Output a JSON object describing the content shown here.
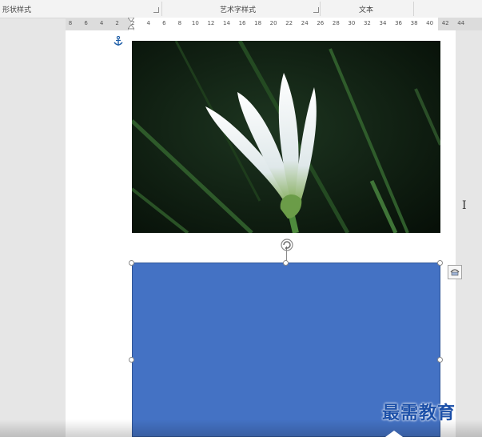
{
  "ribbon": {
    "groups": [
      {
        "label": "形状样式"
      },
      {
        "label": "艺术字样式"
      },
      {
        "label": "文本"
      }
    ]
  },
  "ruler": {
    "ticks": [
      "8",
      "6",
      "4",
      "2",
      "2",
      "4",
      "6",
      "8",
      "10",
      "12",
      "14",
      "16",
      "18",
      "20",
      "22",
      "24",
      "26",
      "28",
      "30",
      "32",
      "34",
      "36",
      "38",
      "40",
      "42",
      "44"
    ]
  },
  "watermark": {
    "text": "最需教育"
  },
  "colors": {
    "shape_fill": "#4472c4",
    "ribbon_bg": "#f3f3f3",
    "page_bg": "#ffffff",
    "workspace_bg": "#e6e6e6"
  },
  "icons": {
    "anchor": "anchor-icon",
    "rotate": "rotate-handle-icon",
    "layout": "layout-options-icon",
    "cursor": "text-cursor-icon"
  }
}
